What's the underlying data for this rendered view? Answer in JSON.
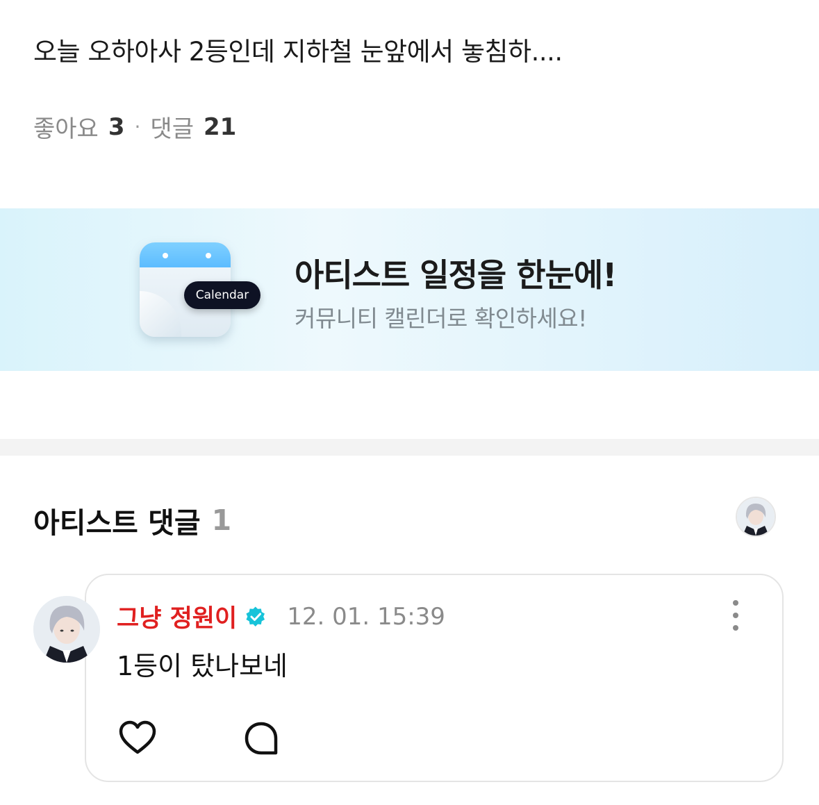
{
  "post": {
    "text": "오늘 오하아사 2등인데 지하철 눈앞에서 놓침하....",
    "likes_label": "좋아요",
    "likes_count": "3",
    "separator": "·",
    "comments_label": "댓글",
    "comments_count": "21"
  },
  "banner": {
    "calendar_badge": "Calendar",
    "title": "아티스트 일정을 한눈에!",
    "subtitle": "커뮤니티 캘린더로 확인하세요!"
  },
  "artist_comments": {
    "title": "아티스트 댓글",
    "count": "1",
    "header_avatar_icon": "artist-avatar"
  },
  "comment": {
    "author": "그냥 정원이",
    "verified_icon": "verified-badge-icon",
    "timestamp": "12. 01. 15:39",
    "text": "1등이 탔나보네",
    "like_icon": "heart-icon",
    "reply_icon": "speech-bubble-icon",
    "more_icon": "more-vertical-icon"
  },
  "colors": {
    "author_name": "#e02020",
    "verified": "#17c3d9",
    "banner_bg": "#dff4fc",
    "divider": "#f3f3f3"
  }
}
